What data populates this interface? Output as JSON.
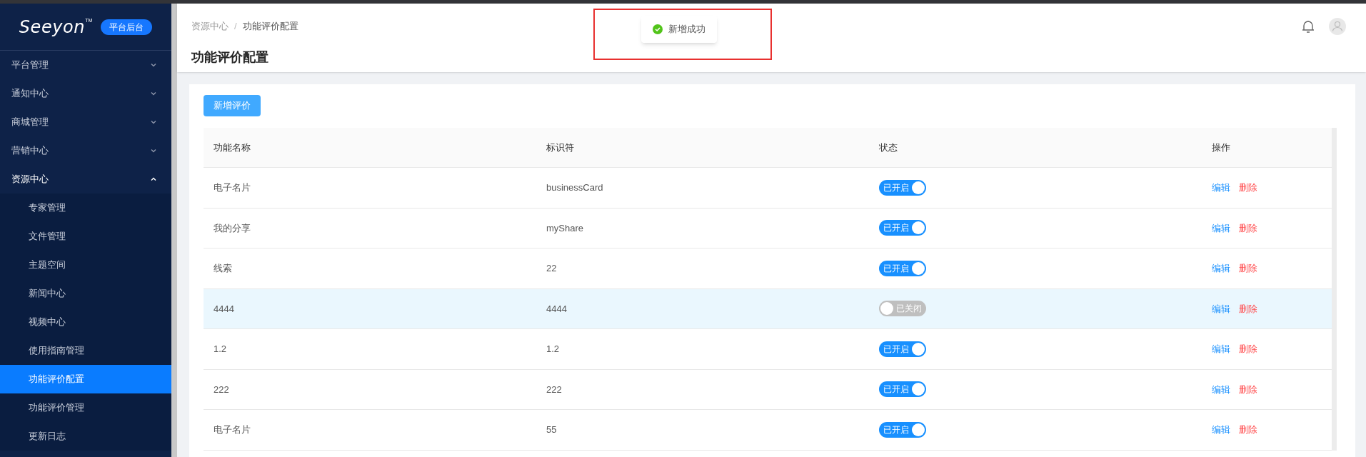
{
  "logo": {
    "text": "Seeyon",
    "mark": "TM",
    "badge": "平台后台"
  },
  "sidebar": {
    "items": [
      {
        "label": "平台管理",
        "expanded": false
      },
      {
        "label": "通知中心",
        "expanded": false
      },
      {
        "label": "商城管理",
        "expanded": false
      },
      {
        "label": "营销中心",
        "expanded": false
      },
      {
        "label": "资源中心",
        "expanded": true,
        "children": [
          {
            "label": "专家管理",
            "selected": false
          },
          {
            "label": "文件管理",
            "selected": false
          },
          {
            "label": "主题空间",
            "selected": false
          },
          {
            "label": "新闻中心",
            "selected": false
          },
          {
            "label": "视频中心",
            "selected": false
          },
          {
            "label": "使用指南管理",
            "selected": false
          },
          {
            "label": "功能评价配置",
            "selected": true
          },
          {
            "label": "功能评价管理",
            "selected": false
          },
          {
            "label": "更新日志",
            "selected": false
          }
        ]
      }
    ]
  },
  "breadcrumb": [
    "资源中心",
    "功能评价配置"
  ],
  "breadcrumb_separator": "/",
  "page_title": "功能评价配置",
  "toast": {
    "message": "新增成功",
    "highlight_frame": true
  },
  "add_button": "新增评价",
  "table": {
    "columns": [
      "功能名称",
      "标识符",
      "状态",
      "操作"
    ],
    "rows": [
      {
        "name": "电子名片",
        "identifier": "businessCard",
        "on": true,
        "status": "已开启",
        "highlighted": false,
        "actions": [
          "编辑",
          "删除"
        ]
      },
      {
        "name": "我的分享",
        "identifier": "myShare",
        "on": true,
        "status": "已开启",
        "highlighted": false,
        "actions": [
          "编辑",
          "删除"
        ]
      },
      {
        "name": "线索",
        "identifier": "22",
        "on": true,
        "status": "已开启",
        "highlighted": false,
        "actions": [
          "编辑",
          "删除"
        ]
      },
      {
        "name": "4444",
        "identifier": "4444",
        "on": false,
        "status": "已关闭",
        "highlighted": true,
        "actions": [
          "编辑",
          "删除"
        ]
      },
      {
        "name": "1.2",
        "identifier": "1.2",
        "on": true,
        "status": "已开启",
        "highlighted": false,
        "actions": [
          "编辑",
          "删除"
        ]
      },
      {
        "name": "222",
        "identifier": "222",
        "on": true,
        "status": "已开启",
        "highlighted": false,
        "actions": [
          "编辑",
          "删除"
        ]
      },
      {
        "name": "电子名片",
        "identifier": "55",
        "on": true,
        "status": "已开启",
        "highlighted": false,
        "actions": [
          "编辑",
          "删除"
        ]
      }
    ]
  }
}
